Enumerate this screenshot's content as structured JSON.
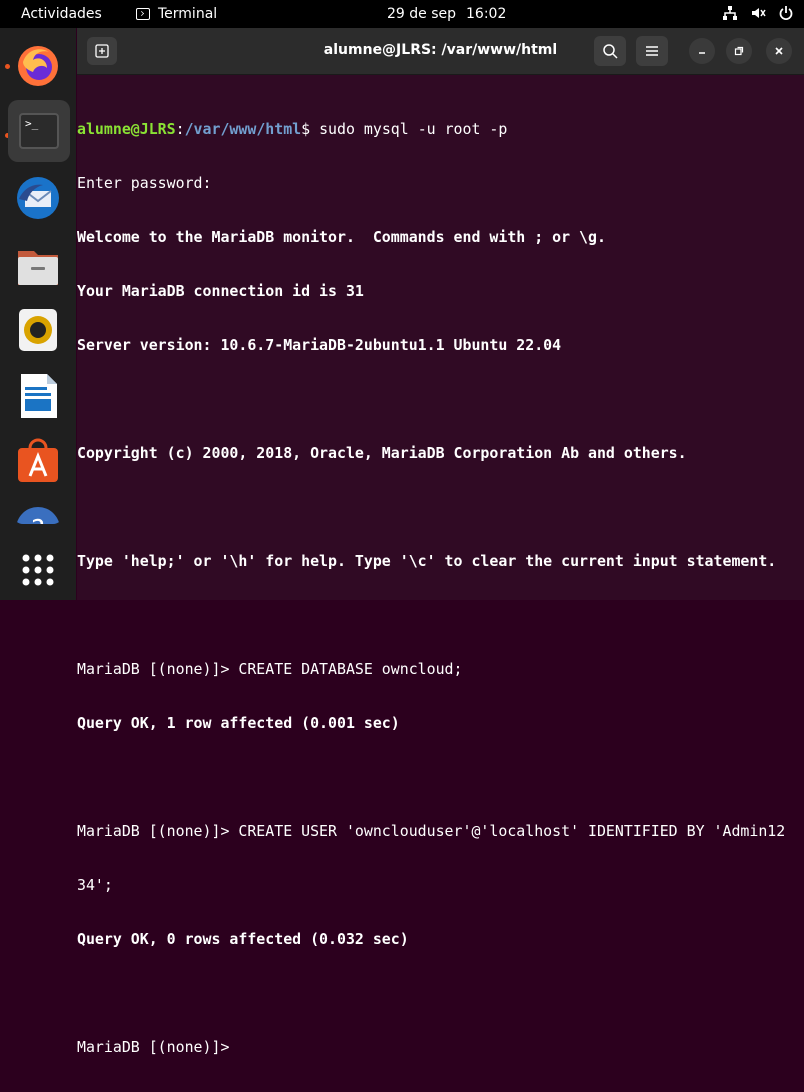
{
  "topbar": {
    "activities": "Actividades",
    "app_name": "Terminal",
    "date": "29 de sep",
    "time": "16:02"
  },
  "window": {
    "title": "alumne@JLRS: /var/www/html"
  },
  "terminal": {
    "prompt_user": "alumne@JLRS",
    "prompt_sep": ":",
    "prompt_path": "/var/www/html",
    "prompt_symbol": "$",
    "command": " sudo mysql -u root -p",
    "lines": [
      "Enter password:",
      "Welcome to the MariaDB monitor.  Commands end with ; or \\g.",
      "Your MariaDB connection id is 31",
      "Server version: 10.6.7-MariaDB-2ubuntu1.1 Ubuntu 22.04",
      "",
      "Copyright (c) 2000, 2018, Oracle, MariaDB Corporation Ab and others.",
      "",
      "Type 'help;' or '\\h' for help. Type '\\c' to clear the current input statement.",
      "",
      "MariaDB [(none)]> CREATE DATABASE owncloud;",
      "Query OK, 1 row affected (0.001 sec)",
      "",
      "MariaDB [(none)]> CREATE USER 'ownclouduser'@'localhost' IDENTIFIED BY 'Admin12",
      "34';",
      "Query OK, 0 rows affected (0.032 sec)",
      "",
      "MariaDB [(none)]> "
    ]
  },
  "dock": {
    "items": [
      "firefox-icon",
      "terminal-icon",
      "thunderbird-icon",
      "files-icon",
      "rhythmbox-icon",
      "writer-icon",
      "software-icon",
      "help-icon",
      "show-apps-icon"
    ]
  },
  "colors": {
    "terminal_bg": "#300a24",
    "prompt_user": "#8ae234",
    "prompt_path": "#729fcf",
    "accent": "#e95420"
  }
}
